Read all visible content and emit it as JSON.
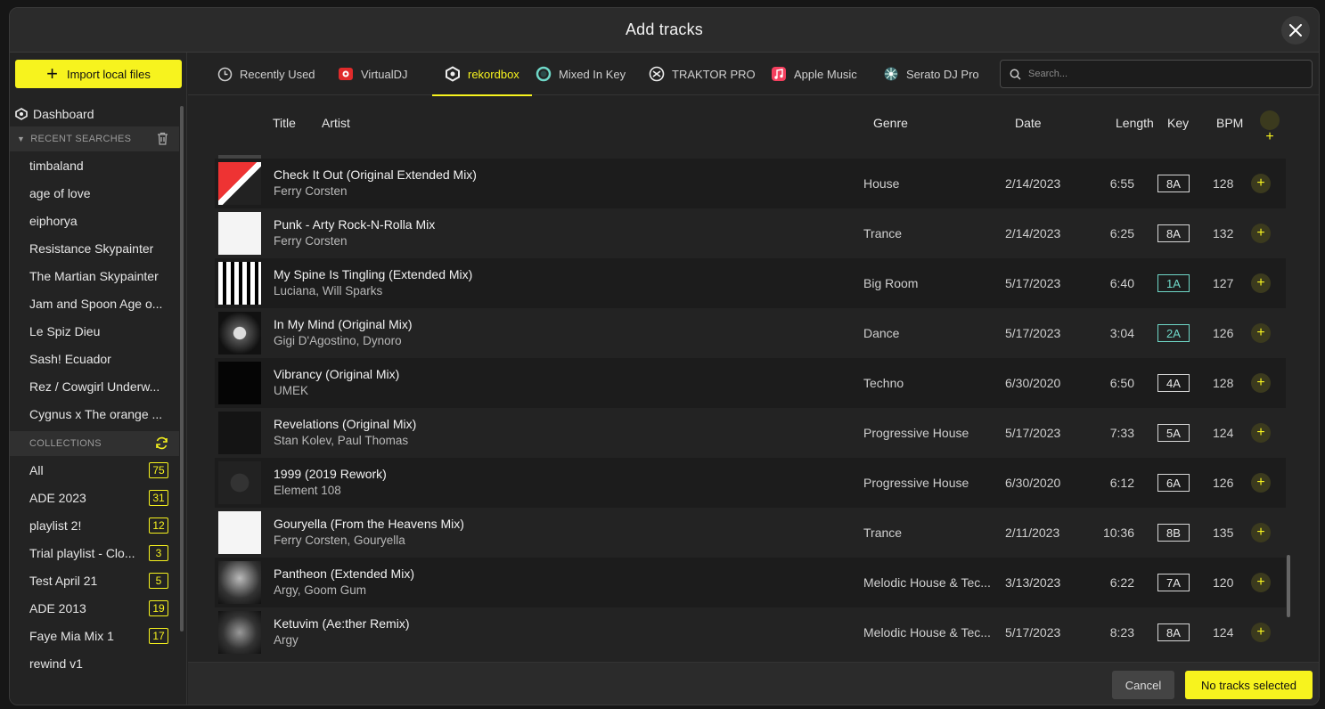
{
  "modal": {
    "title": "Add tracks"
  },
  "sidebar": {
    "import_label": "Import local files",
    "dashboard_label": "Dashboard",
    "recent_header": "RECENT SEARCHES",
    "recent": [
      "timbaland",
      "age of love",
      "eiphorya",
      "Resistance Skypainter",
      "The Martian Skypainter",
      "Jam and Spoon Age o...",
      "Le Spiz Dieu",
      "Sash! Ecuador",
      "Rez / Cowgirl Underw...",
      "Cygnus x The orange ..."
    ],
    "collections_header": "COLLECTIONS",
    "collections": [
      {
        "name": "All",
        "count": "75"
      },
      {
        "name": "ADE 2023",
        "count": "31"
      },
      {
        "name": "playlist 2!",
        "count": "12"
      },
      {
        "name": "Trial playlist - Clo...",
        "count": "3"
      },
      {
        "name": "Test April 21",
        "count": "5"
      },
      {
        "name": "ADE 2013",
        "count": "19"
      },
      {
        "name": "Faye Mia Mix 1",
        "count": "17"
      },
      {
        "name": "rewind v1",
        "count": ""
      }
    ]
  },
  "tabs": [
    {
      "label": "Recently Used",
      "icon": "clock-icon"
    },
    {
      "label": "VirtualDJ",
      "icon": "virtualdj-icon"
    },
    {
      "label": "rekordbox",
      "icon": "rekordbox-icon",
      "active": true
    },
    {
      "label": "Mixed In Key",
      "icon": "mixedinkey-icon"
    },
    {
      "label": "TRAKTOR PRO",
      "icon": "traktor-icon"
    },
    {
      "label": "Apple Music",
      "icon": "apple-music-icon"
    },
    {
      "label": "Serato DJ Pro",
      "icon": "serato-icon"
    }
  ],
  "search": {
    "placeholder": "Search..."
  },
  "table": {
    "headers": {
      "title": "Title",
      "artist": "Artist",
      "genre": "Genre",
      "date": "Date",
      "length": "Length",
      "key": "Key",
      "bpm": "BPM"
    },
    "rows": [
      {
        "title": "Check It Out (Original Extended Mix)",
        "artist": "Ferry Corsten",
        "genre": "House",
        "date": "2/14/2023",
        "length": "6:55",
        "key": "8A",
        "bpm": "128",
        "key_color": "#d8d8d8"
      },
      {
        "title": "Punk - Arty Rock-N-Rolla Mix",
        "artist": "Ferry Corsten",
        "genre": "Trance",
        "date": "2/14/2023",
        "length": "6:25",
        "key": "8A",
        "bpm": "132",
        "key_color": "#d8d8d8"
      },
      {
        "title": "My Spine Is Tingling (Extended Mix)",
        "artist": "Luciana,  Will Sparks",
        "genre": "Big Room",
        "date": "5/17/2023",
        "length": "6:40",
        "key": "1A",
        "bpm": "127",
        "key_color": "#6fd8c8"
      },
      {
        "title": "In My Mind (Original Mix)",
        "artist": "Gigi D'Agostino,  Dynoro",
        "genre": "Dance",
        "date": "5/17/2023",
        "length": "3:04",
        "key": "2A",
        "bpm": "126",
        "key_color": "#6fd8c8"
      },
      {
        "title": "Vibrancy (Original Mix)",
        "artist": "UMEK",
        "genre": "Techno",
        "date": "6/30/2020",
        "length": "6:50",
        "key": "4A",
        "bpm": "128",
        "key_color": "#d8d8d8"
      },
      {
        "title": "Revelations (Original Mix)",
        "artist": "Stan Kolev,  Paul Thomas",
        "genre": "Progressive House",
        "date": "5/17/2023",
        "length": "7:33",
        "key": "5A",
        "bpm": "124",
        "key_color": "#d8d8d8"
      },
      {
        "title": "1999 (2019 Rework)",
        "artist": "Element 108",
        "genre": "Progressive House",
        "date": "6/30/2020",
        "length": "6:12",
        "key": "6A",
        "bpm": "126",
        "key_color": "#d8d8d8"
      },
      {
        "title": "Gouryella (From the Heavens Mix)",
        "artist": "Ferry Corsten,  Gouryella",
        "genre": "Trance",
        "date": "2/11/2023",
        "length": "10:36",
        "key": "8B",
        "bpm": "135",
        "key_color": "#d8d8d8"
      },
      {
        "title": "Pantheon (Extended Mix)",
        "artist": "Argy,  Goom Gum",
        "genre": "Melodic House & Tec...",
        "date": "3/13/2023",
        "length": "6:22",
        "key": "7A",
        "bpm": "120",
        "key_color": "#d8d8d8"
      },
      {
        "title": "Ketuvim (Ae:ther Remix)",
        "artist": "Argy",
        "genre": "Melodic House & Tec...",
        "date": "5/17/2023",
        "length": "8:23",
        "key": "8A",
        "bpm": "124",
        "key_color": "#d8d8d8"
      }
    ]
  },
  "footer": {
    "cancel_label": "Cancel",
    "confirm_label": "No tracks selected"
  },
  "colors": {
    "accent": "#f7f31e",
    "teal_key": "#6fd8c8"
  }
}
